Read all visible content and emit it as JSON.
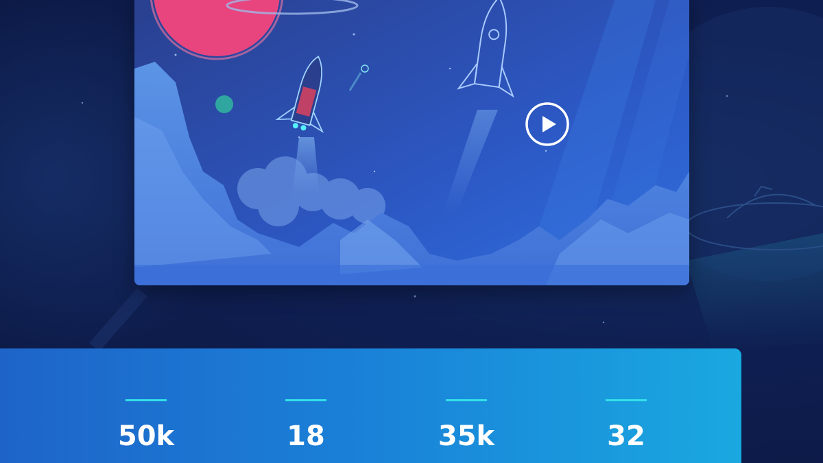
{
  "video": {
    "play_icon": "play-icon"
  },
  "stats": [
    {
      "value": "50k"
    },
    {
      "value": "18"
    },
    {
      "value": "35k"
    },
    {
      "value": "32"
    }
  ],
  "colors": {
    "background": "#0d1a45",
    "panel_start": "#1e64c8",
    "panel_end": "#1aa8e0",
    "accent_line": "#34e0e8",
    "planet": "#e8457f"
  }
}
